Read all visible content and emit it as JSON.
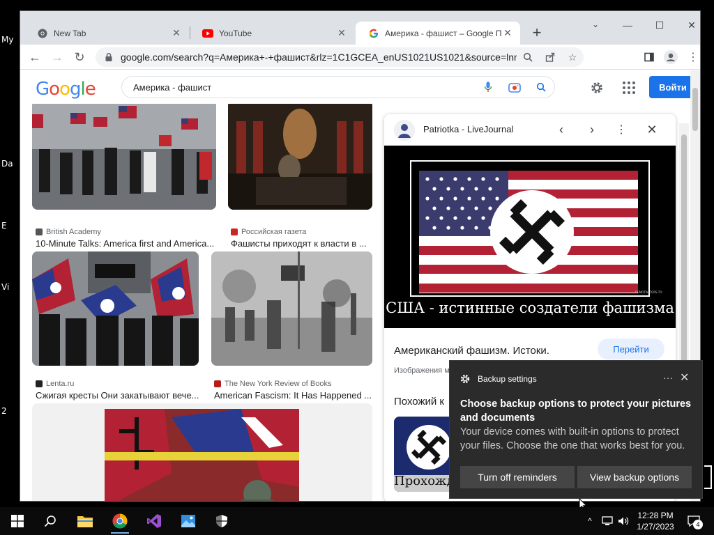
{
  "desktop": {
    "icon_labels": [
      "My",
      "Da",
      "E",
      "Vi",
      "2"
    ]
  },
  "browser": {
    "tabs": [
      {
        "title": "New Tab",
        "icon": "chrome-icon",
        "active": false
      },
      {
        "title": "YouTube",
        "icon": "youtube-icon",
        "active": false
      },
      {
        "title": "Америка - фашист – Google По",
        "icon": "google-g-icon",
        "active": true
      }
    ],
    "new_tab_label": "+",
    "address_url": "google.com/search?q=Америка+-+фашист&rlz=1C1GCEA_enUS1021US1021&source=lnms&tbm=i..."
  },
  "google": {
    "logo": [
      "G",
      "o",
      "o",
      "g",
      "l",
      "e"
    ],
    "logo_colors": [
      "#4285F4",
      "#EA4335",
      "#FBBC05",
      "#4285F4",
      "#34A853",
      "#EA4335"
    ],
    "query": "Америка - фашист",
    "signin_label": "Войти",
    "accent": "#1a73e8"
  },
  "results": [
    {
      "source": "British Academy",
      "caption": "10-Minute Talks: America first and America..."
    },
    {
      "source": "Российская газета",
      "caption": "Фашисты приходят к власти в ..."
    },
    {
      "source": "Lenta.ru",
      "caption": "Сжигая кресты Они закатывают вече..."
    },
    {
      "source": "The New York Review of Books",
      "caption": "American Fascism: It Has Happened ..."
    }
  ],
  "panel": {
    "source": "Patriotka - LiveJournal",
    "image_caption": "США - истинные создатели фашизма",
    "watermark": "DEMOTIVATORS.TO",
    "title": "Американский фашизм. Истоки.",
    "go_label": "Перейти",
    "note": "Изображения м",
    "similar_heading": "Похожий к",
    "similar_thumb_text": "Прохожде"
  },
  "toast": {
    "app": "Backup settings",
    "headline": "Choose backup options to protect your pictures and documents",
    "body": "Your device comes with built-in options to protect your files. Choose the one that works best for you.",
    "btn_dismiss": "Turn off reminders",
    "btn_view": "View backup options",
    "more_label": "···",
    "close_label": "✕"
  },
  "taskbar": {
    "time": "12:28 PM",
    "date": "1/27/2023",
    "notification_count": "4"
  }
}
